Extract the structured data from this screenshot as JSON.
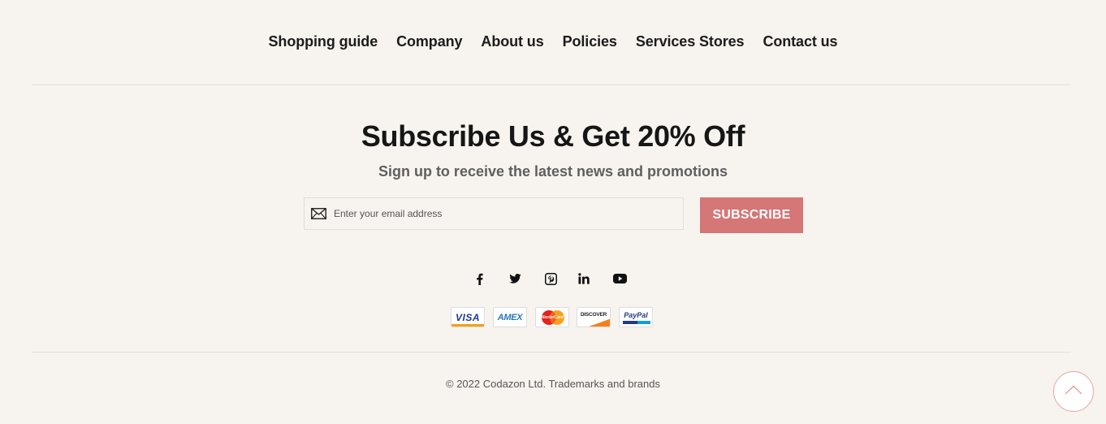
{
  "nav": {
    "items": [
      "Shopping guide",
      "Company",
      "About us",
      "Policies",
      "Services Stores",
      "Contact us"
    ]
  },
  "newsletter": {
    "title": "Subscribe Us & Get 20% Off",
    "subtitle": "Sign up to receive the latest news and promotions",
    "email_placeholder": "Enter your email address",
    "button_label": "SUBSCRIBE"
  },
  "social": [
    "facebook-icon",
    "twitter-icon",
    "pinterest-icon",
    "linkedin-icon",
    "youtube-icon"
  ],
  "payments": [
    {
      "name": "visa",
      "label": "VISA"
    },
    {
      "name": "amex",
      "label": "AMEX"
    },
    {
      "name": "mastercard",
      "label": "MasterCard"
    },
    {
      "name": "discover",
      "label": "DISCOVER"
    },
    {
      "name": "paypal",
      "label": "PayPal"
    }
  ],
  "copyright": "© 2022 Codazon Ltd. Trademarks and brands",
  "colors": {
    "background": "#f7f3ef",
    "accent": "#d57677",
    "divider": "#e6dfd8"
  }
}
